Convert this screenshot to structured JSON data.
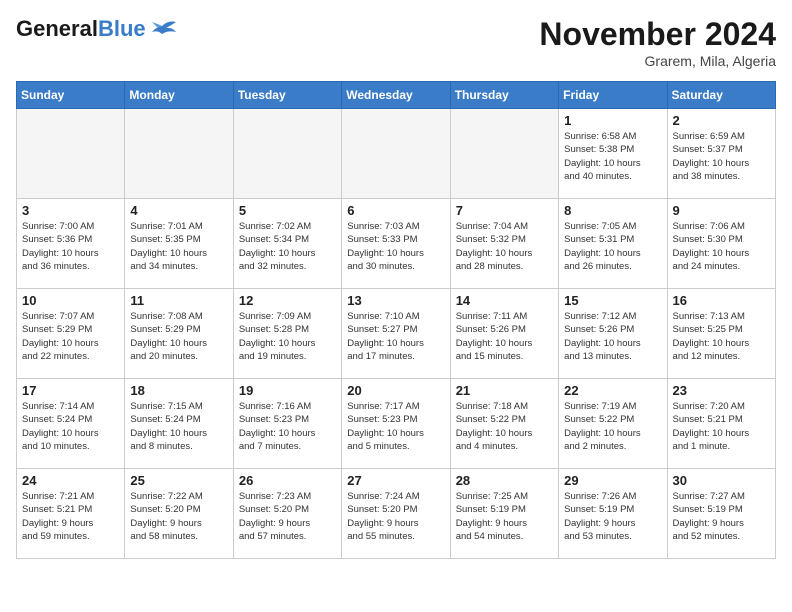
{
  "header": {
    "logo_line1": "General",
    "logo_line2": "Blue",
    "month_title": "November 2024",
    "location": "Grarem, Mila, Algeria"
  },
  "weekdays": [
    "Sunday",
    "Monday",
    "Tuesday",
    "Wednesday",
    "Thursday",
    "Friday",
    "Saturday"
  ],
  "weeks": [
    [
      {
        "day": "",
        "info": ""
      },
      {
        "day": "",
        "info": ""
      },
      {
        "day": "",
        "info": ""
      },
      {
        "day": "",
        "info": ""
      },
      {
        "day": "",
        "info": ""
      },
      {
        "day": "1",
        "info": "Sunrise: 6:58 AM\nSunset: 5:38 PM\nDaylight: 10 hours\nand 40 minutes."
      },
      {
        "day": "2",
        "info": "Sunrise: 6:59 AM\nSunset: 5:37 PM\nDaylight: 10 hours\nand 38 minutes."
      }
    ],
    [
      {
        "day": "3",
        "info": "Sunrise: 7:00 AM\nSunset: 5:36 PM\nDaylight: 10 hours\nand 36 minutes."
      },
      {
        "day": "4",
        "info": "Sunrise: 7:01 AM\nSunset: 5:35 PM\nDaylight: 10 hours\nand 34 minutes."
      },
      {
        "day": "5",
        "info": "Sunrise: 7:02 AM\nSunset: 5:34 PM\nDaylight: 10 hours\nand 32 minutes."
      },
      {
        "day": "6",
        "info": "Sunrise: 7:03 AM\nSunset: 5:33 PM\nDaylight: 10 hours\nand 30 minutes."
      },
      {
        "day": "7",
        "info": "Sunrise: 7:04 AM\nSunset: 5:32 PM\nDaylight: 10 hours\nand 28 minutes."
      },
      {
        "day": "8",
        "info": "Sunrise: 7:05 AM\nSunset: 5:31 PM\nDaylight: 10 hours\nand 26 minutes."
      },
      {
        "day": "9",
        "info": "Sunrise: 7:06 AM\nSunset: 5:30 PM\nDaylight: 10 hours\nand 24 minutes."
      }
    ],
    [
      {
        "day": "10",
        "info": "Sunrise: 7:07 AM\nSunset: 5:29 PM\nDaylight: 10 hours\nand 22 minutes."
      },
      {
        "day": "11",
        "info": "Sunrise: 7:08 AM\nSunset: 5:29 PM\nDaylight: 10 hours\nand 20 minutes."
      },
      {
        "day": "12",
        "info": "Sunrise: 7:09 AM\nSunset: 5:28 PM\nDaylight: 10 hours\nand 19 minutes."
      },
      {
        "day": "13",
        "info": "Sunrise: 7:10 AM\nSunset: 5:27 PM\nDaylight: 10 hours\nand 17 minutes."
      },
      {
        "day": "14",
        "info": "Sunrise: 7:11 AM\nSunset: 5:26 PM\nDaylight: 10 hours\nand 15 minutes."
      },
      {
        "day": "15",
        "info": "Sunrise: 7:12 AM\nSunset: 5:26 PM\nDaylight: 10 hours\nand 13 minutes."
      },
      {
        "day": "16",
        "info": "Sunrise: 7:13 AM\nSunset: 5:25 PM\nDaylight: 10 hours\nand 12 minutes."
      }
    ],
    [
      {
        "day": "17",
        "info": "Sunrise: 7:14 AM\nSunset: 5:24 PM\nDaylight: 10 hours\nand 10 minutes."
      },
      {
        "day": "18",
        "info": "Sunrise: 7:15 AM\nSunset: 5:24 PM\nDaylight: 10 hours\nand 8 minutes."
      },
      {
        "day": "19",
        "info": "Sunrise: 7:16 AM\nSunset: 5:23 PM\nDaylight: 10 hours\nand 7 minutes."
      },
      {
        "day": "20",
        "info": "Sunrise: 7:17 AM\nSunset: 5:23 PM\nDaylight: 10 hours\nand 5 minutes."
      },
      {
        "day": "21",
        "info": "Sunrise: 7:18 AM\nSunset: 5:22 PM\nDaylight: 10 hours\nand 4 minutes."
      },
      {
        "day": "22",
        "info": "Sunrise: 7:19 AM\nSunset: 5:22 PM\nDaylight: 10 hours\nand 2 minutes."
      },
      {
        "day": "23",
        "info": "Sunrise: 7:20 AM\nSunset: 5:21 PM\nDaylight: 10 hours\nand 1 minute."
      }
    ],
    [
      {
        "day": "24",
        "info": "Sunrise: 7:21 AM\nSunset: 5:21 PM\nDaylight: 9 hours\nand 59 minutes."
      },
      {
        "day": "25",
        "info": "Sunrise: 7:22 AM\nSunset: 5:20 PM\nDaylight: 9 hours\nand 58 minutes."
      },
      {
        "day": "26",
        "info": "Sunrise: 7:23 AM\nSunset: 5:20 PM\nDaylight: 9 hours\nand 57 minutes."
      },
      {
        "day": "27",
        "info": "Sunrise: 7:24 AM\nSunset: 5:20 PM\nDaylight: 9 hours\nand 55 minutes."
      },
      {
        "day": "28",
        "info": "Sunrise: 7:25 AM\nSunset: 5:19 PM\nDaylight: 9 hours\nand 54 minutes."
      },
      {
        "day": "29",
        "info": "Sunrise: 7:26 AM\nSunset: 5:19 PM\nDaylight: 9 hours\nand 53 minutes."
      },
      {
        "day": "30",
        "info": "Sunrise: 7:27 AM\nSunset: 5:19 PM\nDaylight: 9 hours\nand 52 minutes."
      }
    ]
  ]
}
